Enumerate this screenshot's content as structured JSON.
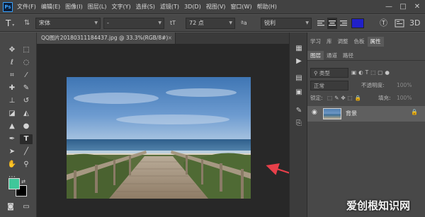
{
  "menubar": {
    "logo": "Ps",
    "items": [
      "文件(F)",
      "编辑(E)",
      "图像(I)",
      "图层(L)",
      "文字(Y)",
      "选择(S)",
      "滤镜(T)",
      "3D(D)",
      "视图(V)",
      "窗口(W)",
      "帮助(H)"
    ],
    "minimize": "—",
    "maximize": "□",
    "close": "✕"
  },
  "options": {
    "tool_icon": "T",
    "font_family": "宋体",
    "font_style": "-",
    "size_icon": "tT",
    "font_size": "72 点",
    "aa_icon": "ªa",
    "antialias": "锐利",
    "text_color": "#2020c8"
  },
  "document": {
    "tab_title": "QQ图片20180311184437.jpg @ 33.3%(RGB/8#)",
    "close": "×"
  },
  "panel": {
    "top_tabs": [
      "学习",
      "库",
      "调整",
      "色板",
      "属性"
    ],
    "active_top_tab": "属性",
    "layer_tabs": [
      "图层",
      "通道",
      "路径"
    ],
    "active_layer_tab": "图层",
    "kind_label": "类型",
    "blend_mode": "正常",
    "opacity_label": "不透明度:",
    "opacity_value": "100%",
    "lock_label": "锁定:",
    "fill_label": "填充:",
    "fill_value": "100%",
    "layer_name": "背景"
  },
  "watermark": "爱创根知识网",
  "colors": {
    "foreground": "#3fc79a",
    "background": "#000000",
    "arrow": "#e8404a"
  }
}
